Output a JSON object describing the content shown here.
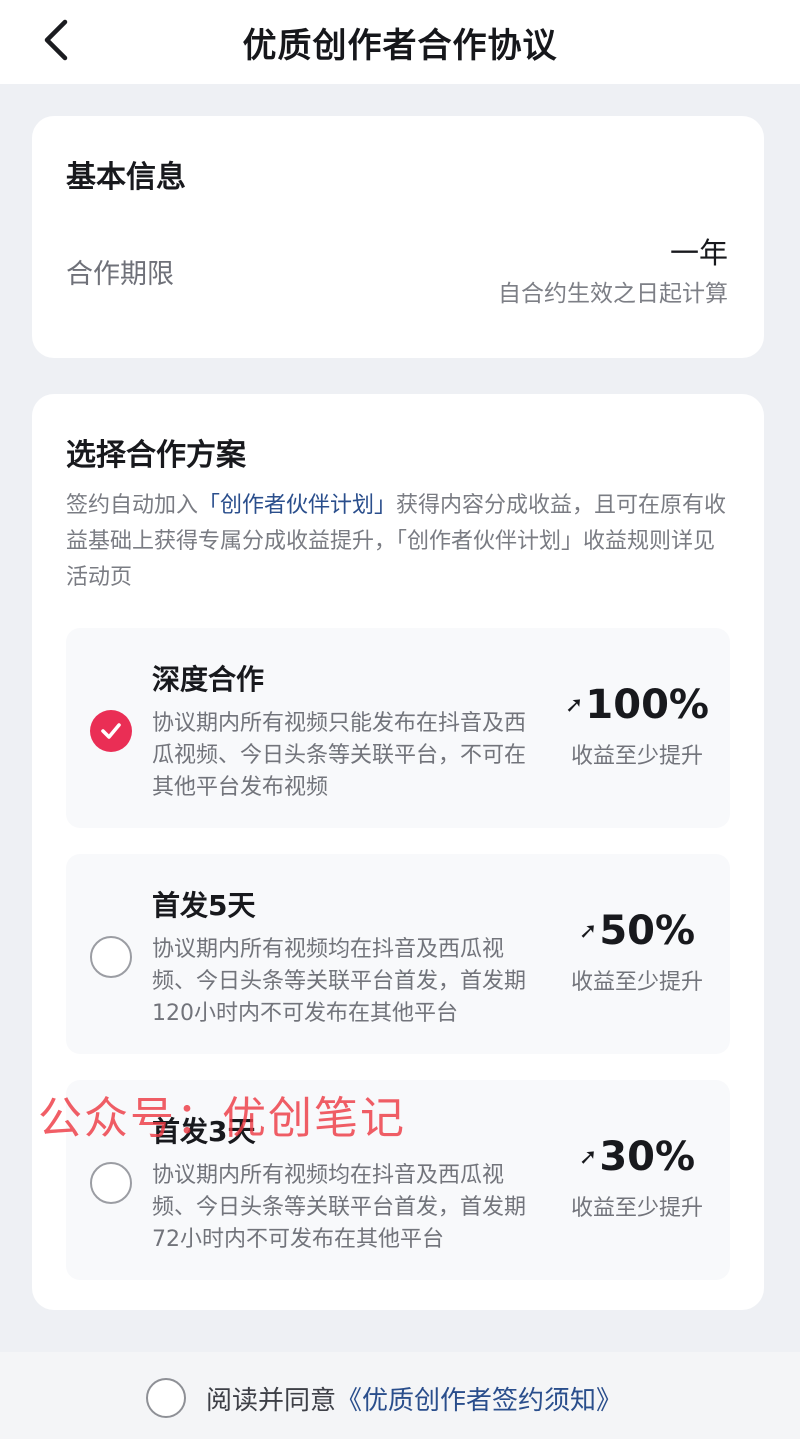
{
  "header": {
    "title": "优质创作者合作协议",
    "back_icon": "chevron-left-icon"
  },
  "basic_info": {
    "heading": "基本信息",
    "term_label": "合作期限",
    "term_value": "一年",
    "term_note": "自合约生效之日起计算"
  },
  "plan": {
    "heading": "选择合作方案",
    "desc_prefix": "签约自动加入",
    "desc_link": "「创作者伙伴计划」",
    "desc_suffix": "获得内容分成收益，且可在原有收益基础上获得专属分成收益提升，「创作者伙伴计划」收益规则详见活动页",
    "options": [
      {
        "title": "深度合作",
        "desc": "协议期内所有视频只能发布在抖音及西瓜视频、今日头条等关联平台，不可在其他平台发布视频",
        "boost": "100%",
        "boost_label": "收益至少提升",
        "selected": true
      },
      {
        "title": "首发5天",
        "desc": "协议期内所有视频均在抖音及西瓜视频、今日头条等关联平台首发，首发期120小时内不可发布在其他平台",
        "boost": "50%",
        "boost_label": "收益至少提升",
        "selected": false
      },
      {
        "title": "首发3天",
        "desc": "协议期内所有视频均在抖音及西瓜视频、今日头条等关联平台首发，首发期72小时内不可发布在其他平台",
        "boost": "30%",
        "boost_label": "收益至少提升",
        "selected": false
      }
    ]
  },
  "watermark": "公众号：优创笔记",
  "footer": {
    "agree_prefix": "阅读并同意",
    "agree_link": "《优质创作者签约须知》"
  },
  "colors": {
    "accent": "#ea2e55",
    "link": "#2a4e8c",
    "watermark": "#ee3b45"
  }
}
